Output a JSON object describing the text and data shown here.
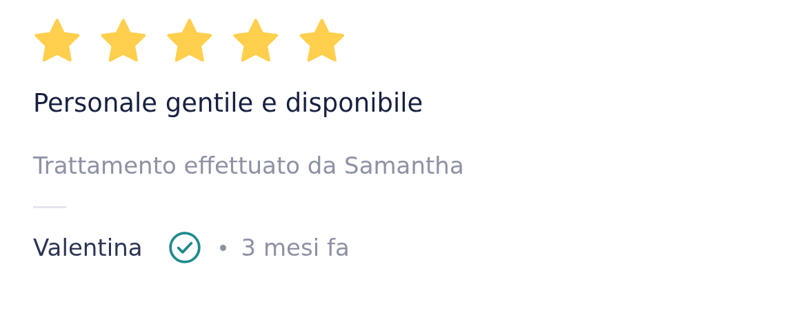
{
  "review": {
    "stars": 5,
    "title": "Personale gentile e disponibile",
    "treatment": "Trattamento effettuato da Samantha",
    "author": "Valentina",
    "verified": true,
    "time": "3 mesi fa"
  }
}
